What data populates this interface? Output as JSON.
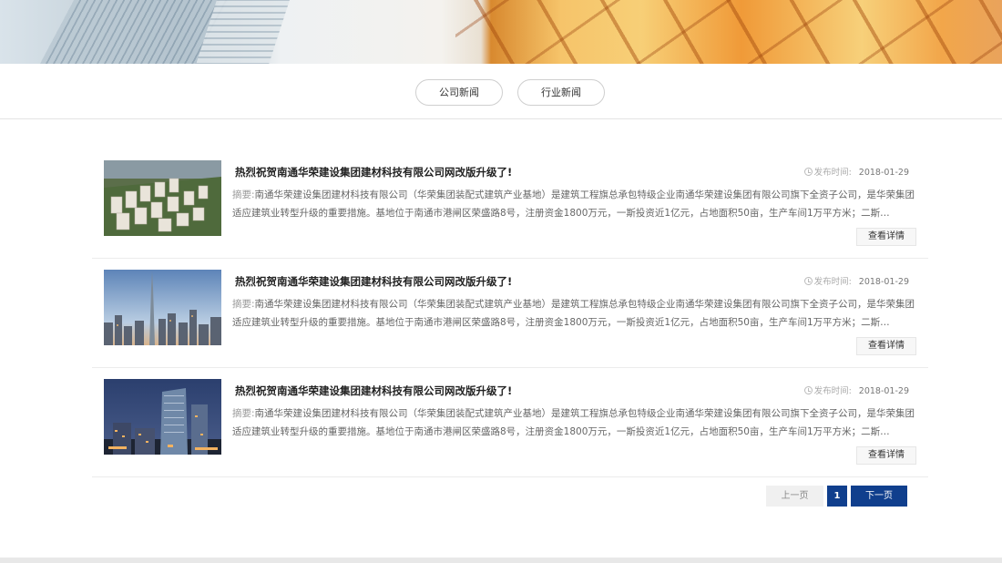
{
  "tabs": [
    {
      "label": "公司新闻"
    },
    {
      "label": "行业新闻"
    }
  ],
  "news": [
    {
      "title": "热烈祝贺南通华荣建设集团建材科技有限公司网改版升级了!",
      "date_label": "发布时间:",
      "date": "2018-01-29",
      "summary_label": "摘要:",
      "summary": "南通华荣建设集团建材科技有限公司（华荣集团装配式建筑产业基地）是建筑工程旗总承包特级企业南通华荣建设集团有限公司旗下全资子公司，是华荣集团适应建筑业转型升级的重要措施。基地位于南通市港闸区荣盛路8号，注册资金1800万元，一斯投资近1亿元，占地面积50亩，生产车间1万平方米；二斯…",
      "detail_label": "查看详情"
    },
    {
      "title": "热烈祝贺南通华荣建设集团建材科技有限公司网改版升级了!",
      "date_label": "发布时间:",
      "date": "2018-01-29",
      "summary_label": "摘要:",
      "summary": "南通华荣建设集团建材科技有限公司（华荣集团装配式建筑产业基地）是建筑工程旗总承包特级企业南通华荣建设集团有限公司旗下全资子公司，是华荣集团适应建筑业转型升级的重要措施。基地位于南通市港闸区荣盛路8号，注册资金1800万元，一斯投资近1亿元，占地面积50亩，生产车间1万平方米；二斯…",
      "detail_label": "查看详情"
    },
    {
      "title": "热烈祝贺南通华荣建设集团建材科技有限公司网改版升级了!",
      "date_label": "发布时间:",
      "date": "2018-01-29",
      "summary_label": "摘要:",
      "summary": "南通华荣建设集团建材科技有限公司（华荣集团装配式建筑产业基地）是建筑工程旗总承包特级企业南通华荣建设集团有限公司旗下全资子公司，是华荣集团适应建筑业转型升级的重要措施。基地位于南通市港闸区荣盛路8号，注册资金1800万元，一斯投资近1亿元，占地面积50亩，生产车间1万平方米；二斯…",
      "detail_label": "查看详情"
    }
  ],
  "pagination": {
    "prev_label": "上一页",
    "current_page": "1",
    "next_label": "下一页"
  },
  "colors": {
    "accent": "#103f8d"
  },
  "icons": {
    "date": "clock-icon"
  }
}
